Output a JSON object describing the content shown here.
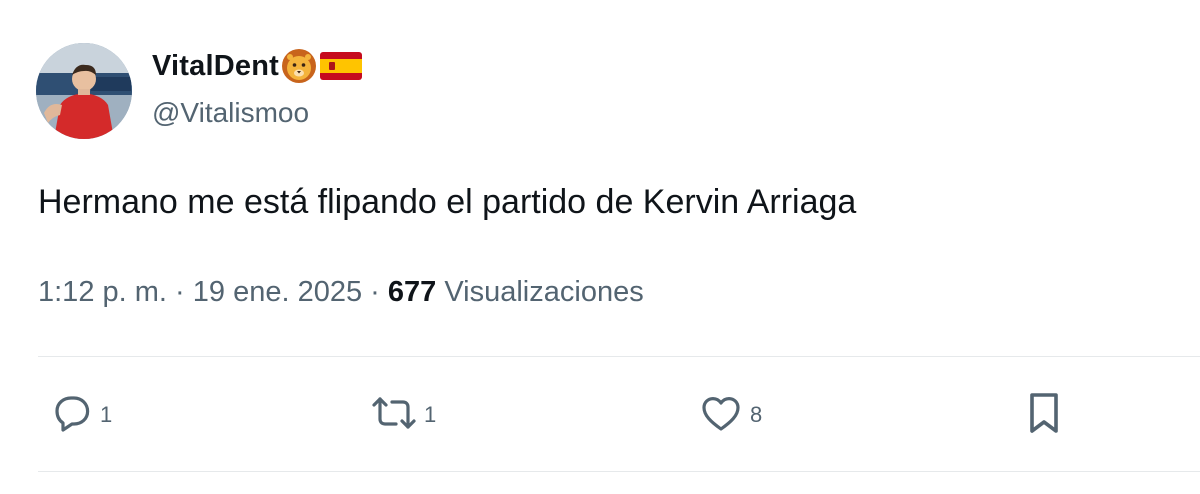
{
  "user": {
    "display_name": "VitalDent",
    "name_emojis": [
      "lion-face-icon",
      "spain-flag-icon"
    ],
    "handle": "@Vitalismoo",
    "avatar_icon": "avatar-photo"
  },
  "tweet": {
    "text": "Hermano me está flipando el partido de Kervin Arriaga"
  },
  "meta": {
    "time": "1:12 p. m.",
    "separator": "·",
    "date": "19 ene. 2025",
    "views_count": "677",
    "views_label": "Visualizaciones"
  },
  "actions": {
    "reply": {
      "icon": "reply-icon",
      "count": "1"
    },
    "retweet": {
      "icon": "retweet-icon",
      "count": "1"
    },
    "like": {
      "icon": "heart-icon",
      "count": "8"
    },
    "bookmark": {
      "icon": "bookmark-icon"
    }
  },
  "colors": {
    "text_primary": "#0f1419",
    "text_secondary": "#536471",
    "divider": "#e6e9eb"
  }
}
